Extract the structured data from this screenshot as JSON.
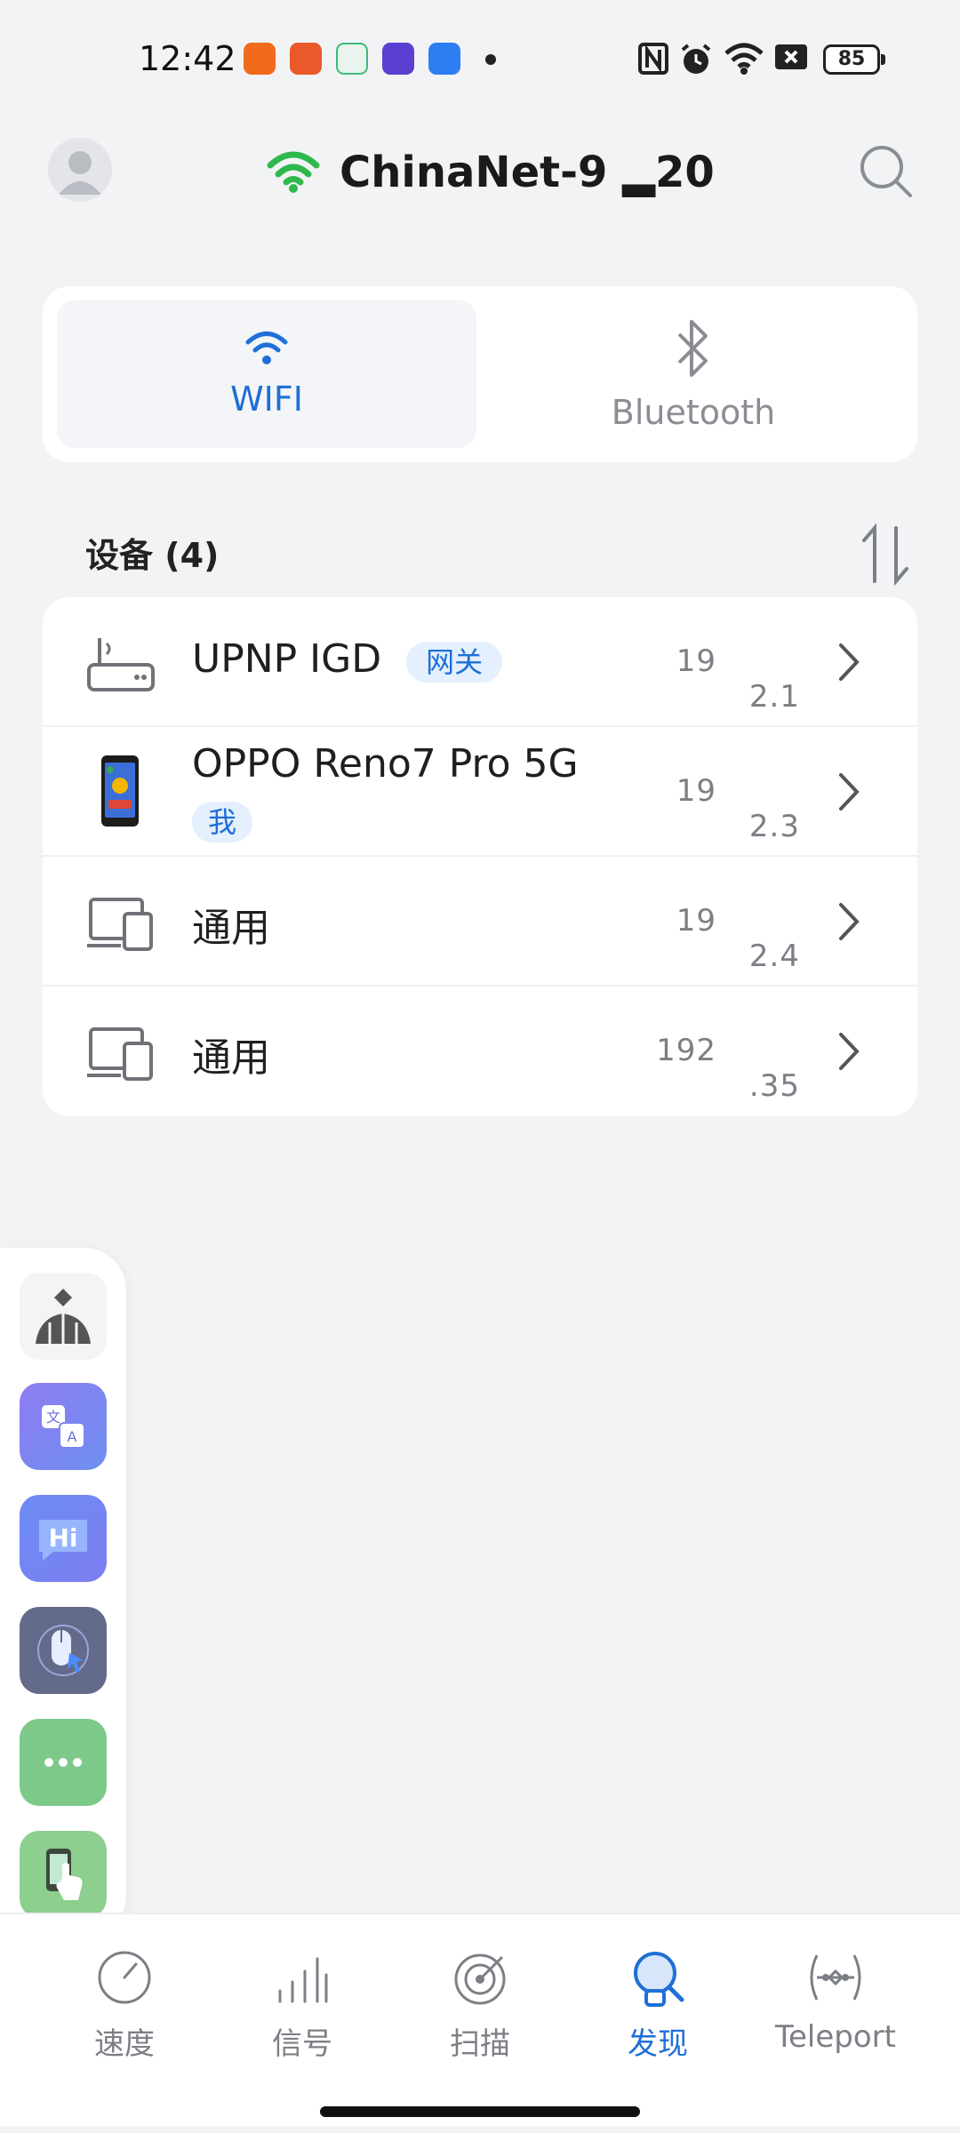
{
  "status_bar": {
    "time": "12:42",
    "battery": "85"
  },
  "header": {
    "network_name": "ChinaNet-9 ▂20",
    "icons": [
      "avatar",
      "wifi-icon",
      "search-icon"
    ]
  },
  "tabs": [
    {
      "label": "WIFI",
      "icon": "wifi-icon",
      "active": true
    },
    {
      "label": "Bluetooth",
      "icon": "bluetooth-icon",
      "active": false
    }
  ],
  "section": {
    "title": "设备 (4)"
  },
  "devices": [
    {
      "name": "UPNP IGD",
      "badge": "网关",
      "ip_start": "19",
      "ip_end": "2.1",
      "icon": "router-icon"
    },
    {
      "name": "OPPO Reno7 Pro 5G",
      "badge": "我",
      "ip_start": "19",
      "ip_end": "2.3",
      "icon": "phone-icon"
    },
    {
      "name": "通用",
      "badge": "",
      "ip_start": "19",
      "ip_end": "2.4",
      "icon": "devices-icon"
    },
    {
      "name": "通用",
      "badge": "",
      "ip_start": "192",
      "ip_end": ".35",
      "icon": "devices-icon"
    }
  ],
  "side_panel": [
    {
      "icon": "person-icon"
    },
    {
      "icon": "translate-icon"
    },
    {
      "icon": "hi-chat-icon"
    },
    {
      "icon": "mouse-icon"
    },
    {
      "icon": "more-icon"
    },
    {
      "icon": "phone-touch-icon"
    }
  ],
  "bottom_nav": [
    {
      "label": "速度",
      "icon": "speed-icon",
      "active": false
    },
    {
      "label": "信号",
      "icon": "signal-icon",
      "active": false
    },
    {
      "label": "扫描",
      "icon": "scan-icon",
      "active": false
    },
    {
      "label": "发现",
      "icon": "discover-icon",
      "active": true
    },
    {
      "label": "Teleport",
      "icon": "teleport-icon",
      "active": false
    }
  ],
  "colors": {
    "accent": "#1f6fd6",
    "wifi_green": "#2fb84d",
    "background": "#f2f3f5"
  }
}
